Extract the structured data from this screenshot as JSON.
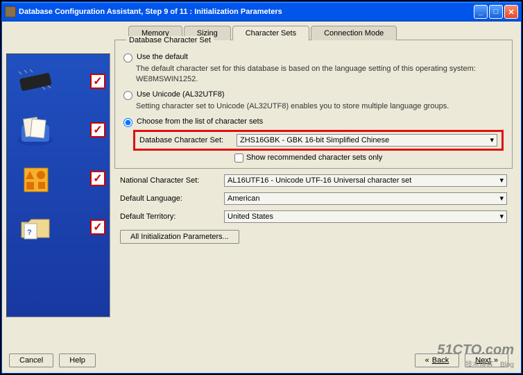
{
  "window": {
    "title": "Database Configuration Assistant, Step 9 of 11 : Initialization Parameters"
  },
  "tabs": {
    "memory": "Memory",
    "sizing": "Sizing",
    "charsets": "Character Sets",
    "connmode": "Connection Mode"
  },
  "fieldset": {
    "legend": "Database Character Set"
  },
  "options": {
    "default": {
      "label": "Use the default",
      "desc": "The default character set for this database is based on the language setting of this operating system: WE8MSWIN1252."
    },
    "unicode": {
      "label": "Use Unicode (AL32UTF8)",
      "desc": "Setting character set to Unicode (AL32UTF8) enables you to store multiple language groups."
    },
    "choose": {
      "label": "Choose from the list of character sets",
      "db_label": "Database Character Set:",
      "db_value": "ZHS16GBK - GBK 16-bit Simplified Chinese",
      "show_recommended": "Show recommended character sets only"
    }
  },
  "form": {
    "national_label": "National Character Set:",
    "national_value": "AL16UTF16 - Unicode UTF-16 Universal character set",
    "lang_label": "Default Language:",
    "lang_value": "American",
    "terr_label": "Default Territory:",
    "terr_value": "United States"
  },
  "buttons": {
    "all_params": "All Initialization Parameters...",
    "cancel": "Cancel",
    "help": "Help",
    "back": "Back",
    "next": "Next"
  },
  "watermark": {
    "big": "51CTO.com",
    "small": "技术博客　Blog"
  }
}
